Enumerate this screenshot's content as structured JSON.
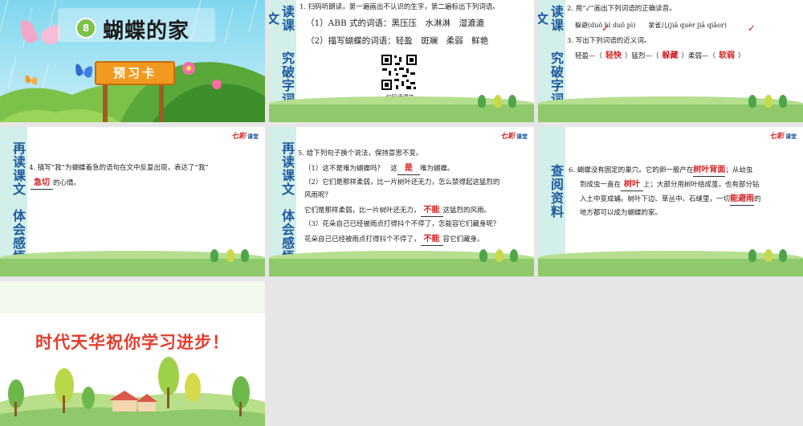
{
  "slide1": {
    "lesson_number": "8",
    "title": "蝴蝶的家",
    "card_label": "预习卡"
  },
  "slide2": {
    "side_title_top": "读课文",
    "side_title_bottom": "究破字词",
    "q1": "1. 扫码听朗读，第一遍画出不认识的生字，第二遍标出下列词语。",
    "q1_line1": "（1）ABB 式的词语：黑压压　水淋淋　湿漉漉",
    "q1_line2": "（2）描写蝴蝶的词语：轻盈　斑斓　柔弱　鲜艳",
    "qr_caption": "扫码读课文"
  },
  "slide3": {
    "side_title_top": "读课文",
    "side_title_bottom": "究破字词",
    "q2": "2. 用“✓”画出下列词语的正确读音。",
    "q2_items": "躲避(duǒ bì  duǒ pì)　　家雀儿(jiā quèr  jiā qiǎor)",
    "q3": "3. 写出下列词语的近义词。",
    "q3_w1": "轻盈—（",
    "q3_a1": "轻快",
    "q3_w2": "）猛烈—（",
    "q3_a2": "躲藏",
    "q3_w3": "）柔弱—（",
    "q3_a3": "软弱",
    "q3_end": "）"
  },
  "slide4": {
    "side_title_top": "再读课文",
    "side_title_bottom": "体会感悟",
    "logo": "七彩",
    "logo_sub": "课堂",
    "q4": "4. 描写“我”为蝴蝶着急的语句在文中反复出现，表达了“我”",
    "q4_answer": "急切",
    "q4_end": "的心情。"
  },
  "slide5": {
    "side_title_top": "再读课文",
    "side_title_bottom": "体会感悟",
    "logo": "七彩",
    "logo_sub": "课堂",
    "q5": "5. 给下列句子换个说法，保持意思不变。",
    "l1a": "（1）这不是难为蝴蝶吗？　这",
    "l1_ans": "是",
    "l1b": "难为蝴蝶。",
    "l2": "（2）它们是那样柔弱，比一片树叶还无力，怎么禁得起这猛烈的",
    "l3": "风雨呢？",
    "l4a": "它们是那样柔弱，比一片树叶还无力，",
    "l4_ans": "不能",
    "l4b": "这猛烈的风雨。",
    "l5": "（3）花朵自己已经被雨点打得抖个不停了，怎能容它们藏身呢？",
    "l6a": "花朵自己已经被雨点打得抖个不停了，",
    "l6_ans": "不能",
    "l6b": "容它们藏身。"
  },
  "slide6": {
    "side_title": "查阅资料",
    "logo": "七彩",
    "logo_sub": "课堂",
    "l1a": "6. 蝴蝶没有固定的巢穴。它的卵一般产在",
    "l1_ans": "树叶背面",
    "l1b": "；从幼虫",
    "l2a": "到成虫一直在",
    "l2_ans": "树叶",
    "l2b": "上；大部分用树叶结成茧，也有部分钻",
    "l3": "入土中变成蛹。树叶下边、草丛中、石缝里，一切",
    "l3_ans": "能避雨",
    "l3b": "的",
    "l4": "地方都可以成为蝴蝶的家。"
  },
  "slide7": {
    "message": "时代天华祝你学习进步！"
  }
}
